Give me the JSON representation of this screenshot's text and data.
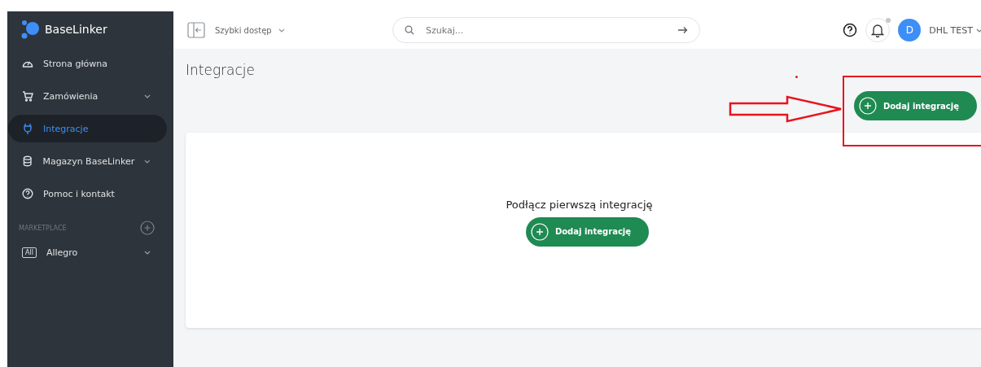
{
  "sidebar": {
    "logo": "BaseLinker",
    "items": [
      {
        "label": "Strona główna",
        "kind": "gauge",
        "expandable": false,
        "selected": false
      },
      {
        "label": "Zamówienia",
        "kind": "cart",
        "expandable": true,
        "selected": false
      },
      {
        "label": "Integracje",
        "kind": "plug",
        "expandable": false,
        "selected": true
      },
      {
        "label": "Magazyn BaseLinker",
        "kind": "database",
        "expandable": true,
        "selected": false
      },
      {
        "label": "Pomoc i kontakt",
        "kind": "help",
        "expandable": false,
        "selected": false
      }
    ],
    "section_title": "MARKETPLACE",
    "marketplace": [
      {
        "badge": "All",
        "label": "Allegro",
        "expandable": true
      }
    ]
  },
  "header": {
    "quick_access": "Szybki dostęp",
    "search": {
      "placeholder": "Szukaj..."
    },
    "notification_dot": true,
    "avatar": "D",
    "user": "DHL TEST"
  },
  "page": {
    "title": "Integracje",
    "add_button": "Dodaj integrację"
  },
  "empty_state": {
    "heading": "Podłącz pierwszą integrację",
    "button": "Dodaj integrację"
  }
}
